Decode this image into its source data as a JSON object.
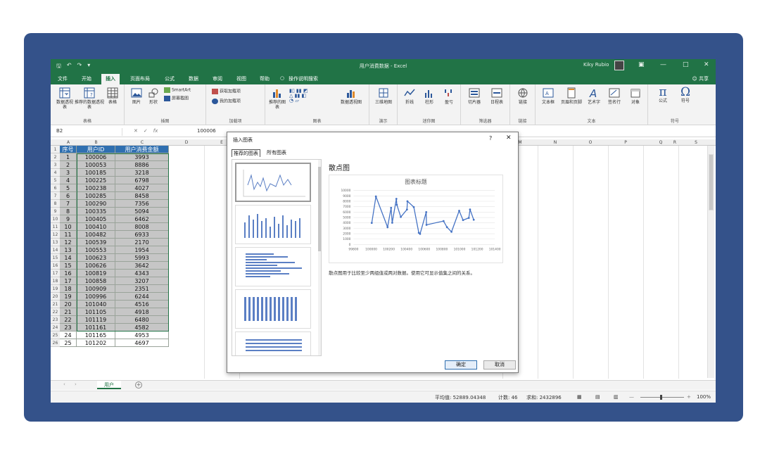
{
  "window": {
    "title": "用户消费数据  -  Excel",
    "user": "Kiky Rubio",
    "share_label": "共享"
  },
  "tabs": [
    "文件",
    "开始",
    "插入",
    "页面布局",
    "公式",
    "数据",
    "审阅",
    "视图",
    "帮助",
    "操作说明搜索"
  ],
  "active_tab": "插入",
  "ribbon": {
    "groups": [
      {
        "label": "表格",
        "buttons": [
          "数据透视表",
          "推荐的数据透视表",
          "表格"
        ]
      },
      {
        "label": "插图",
        "buttons": [
          "图片",
          "形状",
          "SmartArt",
          "屏幕截图"
        ]
      },
      {
        "label": "加载项",
        "buttons": [
          "获取加载项",
          "我的加载项"
        ]
      },
      {
        "label": "图表",
        "buttons": [
          "推荐的图表",
          "数据透视图"
        ]
      },
      {
        "label": "演示",
        "buttons": [
          "三维地图"
        ]
      },
      {
        "label": "迷你图",
        "buttons": [
          "折线",
          "柱形",
          "盈亏"
        ]
      },
      {
        "label": "筛选器",
        "buttons": [
          "切片器",
          "日程表"
        ]
      },
      {
        "label": "链接",
        "buttons": [
          "链接"
        ]
      },
      {
        "label": "文本",
        "buttons": [
          "文本框",
          "页眉和页脚",
          "艺术字",
          "签名行",
          "对象"
        ]
      },
      {
        "label": "符号",
        "buttons": [
          "公式",
          "符号"
        ]
      }
    ]
  },
  "formula_bar": {
    "name_box": "B2",
    "fx": "fx",
    "value": "100006"
  },
  "columns": [
    "A",
    "B",
    "C",
    "D",
    "E",
    "M",
    "N",
    "O",
    "P",
    "Q",
    "R",
    "S"
  ],
  "table": {
    "headers": [
      "序号",
      "用户ID",
      "用户消费金额"
    ],
    "rows": [
      [
        "1",
        "100006",
        "3993"
      ],
      [
        "2",
        "100053",
        "8886"
      ],
      [
        "3",
        "100185",
        "3218"
      ],
      [
        "4",
        "100225",
        "6798"
      ],
      [
        "5",
        "100238",
        "4027"
      ],
      [
        "6",
        "100285",
        "8458"
      ],
      [
        "7",
        "100290",
        "7356"
      ],
      [
        "8",
        "100335",
        "5094"
      ],
      [
        "9",
        "100405",
        "6462"
      ],
      [
        "10",
        "100410",
        "8008"
      ],
      [
        "11",
        "100482",
        "6933"
      ],
      [
        "12",
        "100539",
        "2170"
      ],
      [
        "13",
        "100553",
        "1954"
      ],
      [
        "14",
        "100623",
        "5993"
      ],
      [
        "15",
        "100626",
        "3642"
      ],
      [
        "16",
        "100819",
        "4343"
      ],
      [
        "17",
        "100858",
        "3207"
      ],
      [
        "18",
        "100909",
        "2351"
      ],
      [
        "19",
        "100996",
        "6244"
      ],
      [
        "20",
        "101040",
        "4516"
      ],
      [
        "21",
        "101105",
        "4918"
      ],
      [
        "22",
        "101119",
        "6480"
      ],
      [
        "23",
        "101161",
        "4582"
      ],
      [
        "24",
        "101165",
        "4953"
      ],
      [
        "25",
        "101202",
        "4697"
      ]
    ],
    "row_numbers": [
      "1",
      "2",
      "3",
      "4",
      "5",
      "6",
      "7",
      "8",
      "9",
      "10",
      "11",
      "12",
      "13",
      "14",
      "15",
      "16",
      "17",
      "18",
      "19",
      "20",
      "21",
      "22",
      "23",
      "24",
      "25",
      "26"
    ]
  },
  "sheet_tab": "用户",
  "status": {
    "avg": "平均值: 52889.04348",
    "count": "计数: 46",
    "sum": "求和: 2432896",
    "zoom": "100%"
  },
  "dialog": {
    "title": "插入图表",
    "tab_recommended": "推荐的图表",
    "tab_all": "所有图表",
    "preview_title": "散点图",
    "description": "散点图用于比较至少两组值或两对数据。使用它可显示值集之间的关系。",
    "ok": "确定",
    "cancel": "取消"
  },
  "chart_data": {
    "type": "scatter",
    "title": "图表标题",
    "x": [
      100006,
      100053,
      100185,
      100225,
      100238,
      100285,
      100290,
      100335,
      100405,
      100410,
      100482,
      100539,
      100553,
      100623,
      100626,
      100819,
      100858,
      100909,
      100996,
      101040,
      101105,
      101119,
      101161
    ],
    "y": [
      3993,
      8886,
      3218,
      6798,
      4027,
      8458,
      7356,
      5094,
      6462,
      8008,
      6933,
      2170,
      1954,
      5993,
      3642,
      4343,
      3207,
      2351,
      6244,
      4516,
      4918,
      6480,
      4582
    ],
    "xticks": [
      "99800",
      "100000",
      "100200",
      "100400",
      "100600",
      "100800",
      "101000",
      "101200",
      "101400"
    ],
    "yticks": [
      "0",
      "1000",
      "2000",
      "3000",
      "4000",
      "5000",
      "6000",
      "7000",
      "8000",
      "9000",
      "10000"
    ],
    "xlim": [
      99800,
      101400
    ],
    "ylim": [
      0,
      10000
    ],
    "grid": true,
    "series_color": "#4472c4"
  }
}
